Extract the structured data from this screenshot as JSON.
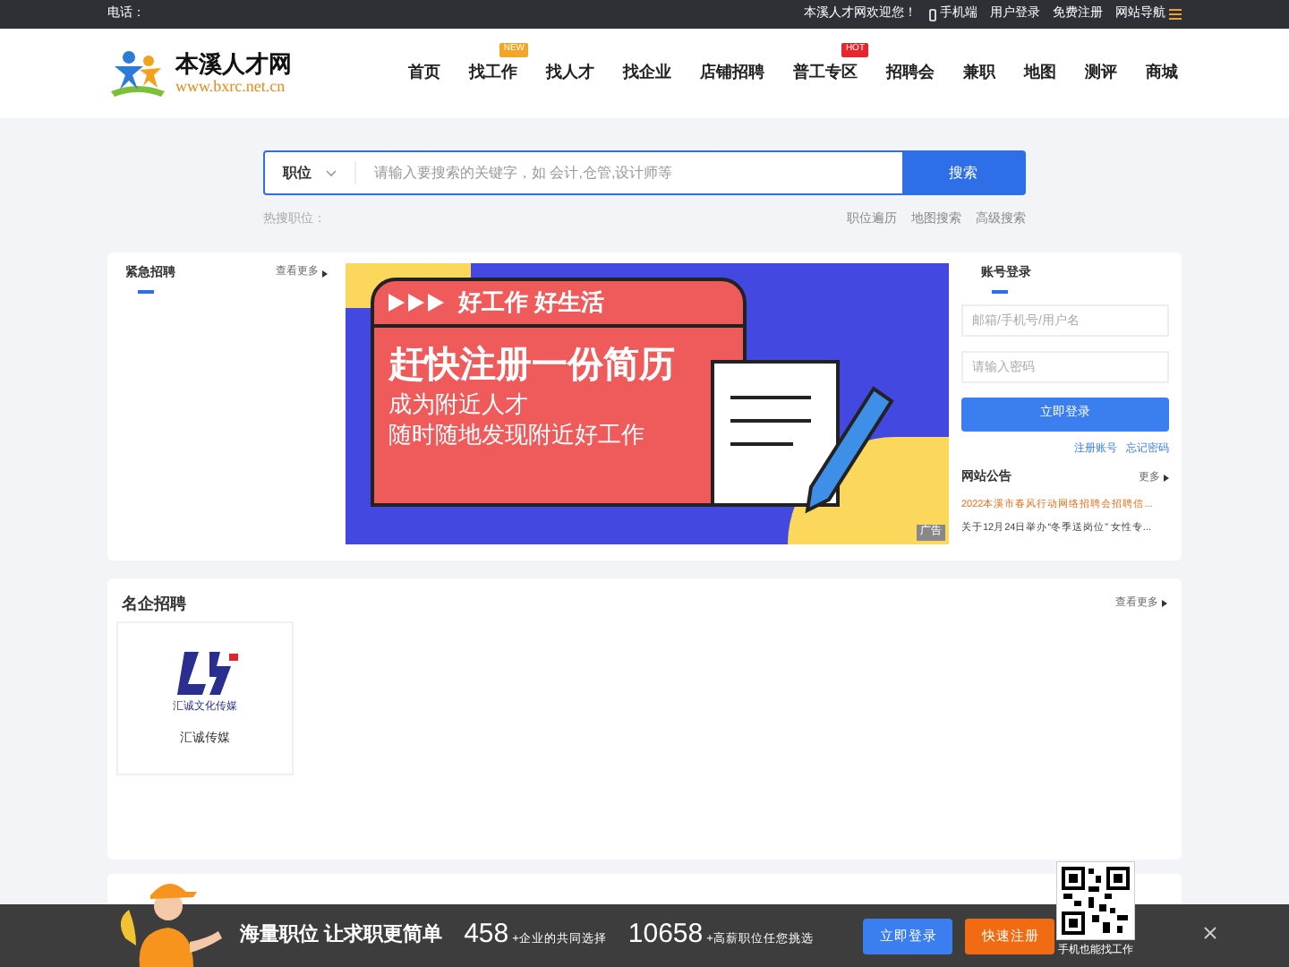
{
  "topbar": {
    "phone_label": "电话：",
    "welcome": "本溪人才网欢迎您！",
    "links": [
      "手机端",
      "用户登录",
      "免费注册",
      "网站导航"
    ]
  },
  "header": {
    "logo_title": "本溪人才网",
    "logo_url": "www.bxrc.net.cn",
    "nav": [
      {
        "label": "首页"
      },
      {
        "label": "找工作",
        "badge": "NEW"
      },
      {
        "label": "找人才"
      },
      {
        "label": "找企业"
      },
      {
        "label": "店铺招聘"
      },
      {
        "label": "普工专区",
        "badge": "HOT"
      },
      {
        "label": "招聘会"
      },
      {
        "label": "兼职"
      },
      {
        "label": "地图"
      },
      {
        "label": "测评"
      },
      {
        "label": "商城"
      }
    ]
  },
  "search": {
    "type": "职位",
    "placeholder": "请输入要搜索的关键字，如 会计,仓管,设计师等",
    "button": "搜索",
    "hot_label": "热搜职位：",
    "links": [
      "职位遍历",
      "地图搜索",
      "高级搜索"
    ]
  },
  "urgent": {
    "title": "紧急招聘",
    "more": "查看更多"
  },
  "banner": {
    "top": "好工作 好生活",
    "headline": "赶快注册一份简历",
    "line1": "成为附近人才",
    "line2": "随时随地发现附近好工作",
    "tag": "广告"
  },
  "login": {
    "title": "账号登录",
    "user_placeholder": "邮箱/手机号/用户名",
    "password_placeholder": "请输入密码",
    "button": "立即登录",
    "links": [
      "注册账号",
      "忘记密码"
    ]
  },
  "notices": {
    "title": "网站公告",
    "more": "更多",
    "items": [
      {
        "text": "2022本溪市春风行动网络招聘会招聘信...",
        "highlight": true
      },
      {
        "text": "关于12月24日举办“冬季送岗位” 女性专...",
        "highlight": false
      }
    ]
  },
  "famous": {
    "title": "名企招聘",
    "more": "查看更多",
    "companies": [
      {
        "name": "汇诚传媒",
        "logo_caption": "汇诚文化传媒"
      }
    ]
  },
  "bottom_bar": {
    "slogan": "海量职位 让求职更简单",
    "stats": [
      {
        "number": "458",
        "label": "+企业的共同选择"
      },
      {
        "number": "10658",
        "label": "+高薪职位任您挑选"
      }
    ],
    "login_button": "立即登录",
    "register_button": "快速注册",
    "qr_caption": "手机也能找工作"
  }
}
